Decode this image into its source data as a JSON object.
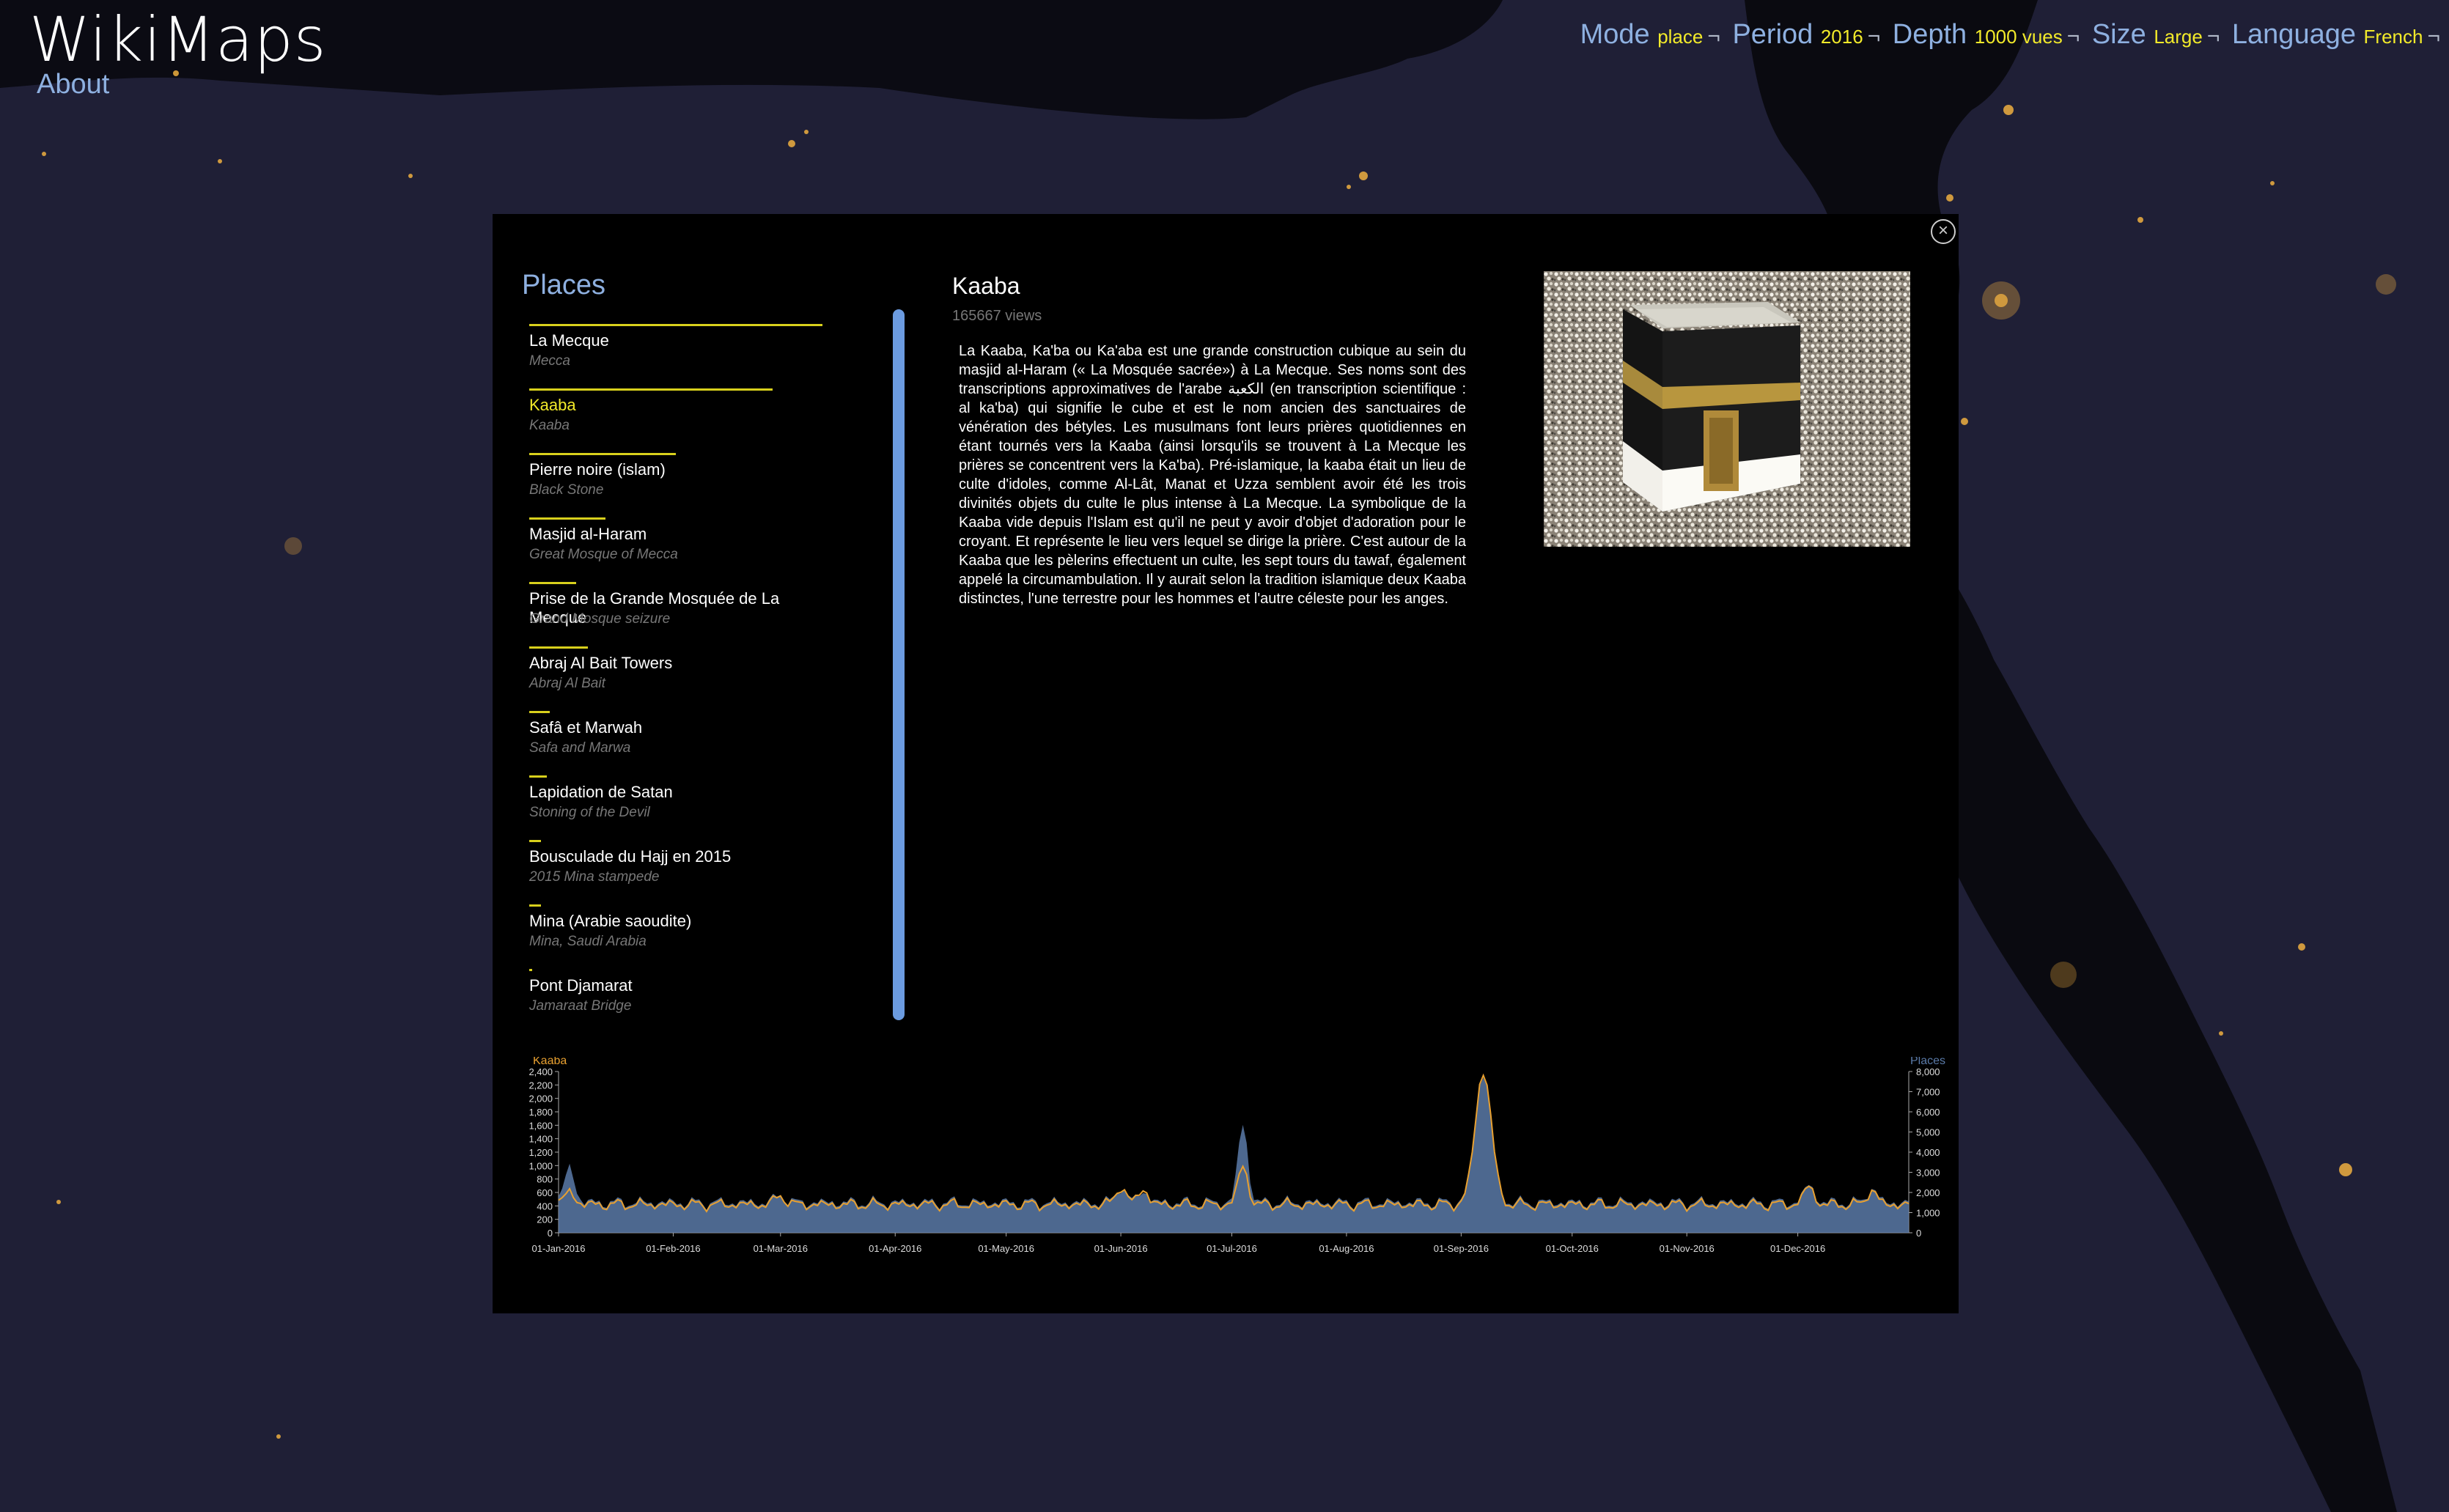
{
  "app": {
    "title": "WikiMaps",
    "about_label": "About"
  },
  "nav": {
    "items": [
      {
        "label": "Mode",
        "value": "place"
      },
      {
        "label": "Period",
        "value": "2016"
      },
      {
        "label": "Depth",
        "value": "1000 vues"
      },
      {
        "label": "Size",
        "value": "Large"
      },
      {
        "label": "Language",
        "value": "French"
      }
    ],
    "separator": "¬"
  },
  "panel": {
    "close_icon": "close-circle-icon",
    "places_title": "Places",
    "places": [
      {
        "name": "La Mecque",
        "english": "Mecca",
        "weight": 1.0,
        "active": false
      },
      {
        "name": "Kaaba",
        "english": "Kaaba",
        "weight": 0.83,
        "active": true
      },
      {
        "name": "Pierre noire (islam)",
        "english": "Black Stone",
        "weight": 0.5,
        "active": false
      },
      {
        "name": "Masjid al-Haram",
        "english": "Great Mosque of Mecca",
        "weight": 0.26,
        "active": false
      },
      {
        "name": "Prise de la Grande Mosquée de La Mecque",
        "english": "Grand Mosque seizure",
        "weight": 0.16,
        "active": false
      },
      {
        "name": "Abraj Al Bait Towers",
        "english": "Abraj Al Bait",
        "weight": 0.2,
        "active": false
      },
      {
        "name": "Safâ et Marwah",
        "english": "Safa and Marwa",
        "weight": 0.07,
        "active": false
      },
      {
        "name": "Lapidation de Satan",
        "english": "Stoning of the Devil",
        "weight": 0.06,
        "active": false
      },
      {
        "name": "Bousculade du Hajj en 2015",
        "english": "2015 Mina stampede",
        "weight": 0.04,
        "active": false
      },
      {
        "name": "Mina (Arabie saoudite)",
        "english": "Mina, Saudi Arabia",
        "weight": 0.04,
        "active": false
      },
      {
        "name": "Pont Djamarat",
        "english": "Jamaraat Bridge",
        "weight": 0.01,
        "active": false
      }
    ],
    "detail": {
      "title": "Kaaba",
      "views": "165667 views",
      "text": "La Kaaba, Ka'ba ou Ka'aba est une grande construction cubique au sein du masjid al-Haram (« La Mosquée sacrée») à La Mecque. Ses noms sont des transcriptions approximatives de l'arabe الكعبة (en transcription scientifique : al ka'ba) qui signifie le cube et est le nom ancien des sanctuaires de vénération des bétyles. Les musulmans font leurs prières quotidiennes en étant tournés vers la Kaaba (ainsi lorsqu'ils se trouvent à La Mecque les prières se concentrent vers la Ka'ba). Pré-islamique, la kaaba était un lieu de culte d'idoles, comme Al-Lât, Manat et Uzza semblent avoir été les trois divinités objets du culte le plus intense à La Mecque. La symbolique de la Kaaba vide depuis l'Islam est qu'il ne peut y avoir d'objet d'adoration pour le croyant. Et représente le lieu vers lequel se dirige la prière. C'est autour de la Kaaba que les pèlerins effectuent un culte, les sept tours du tawaf, également appelé la circumambulation. Il y aurait selon la tradition islamique deux Kaaba distinctes, l'une terrestre pour les hommes et l'autre céleste pour les anges.",
      "image": "kaaba-photo"
    }
  },
  "chart_data": {
    "type": "area",
    "series": [
      {
        "name": "Kaaba",
        "color": "#e8a030",
        "axis": "left",
        "ylim": [
          0,
          2400
        ],
        "yticks": [
          "0",
          "200",
          "400",
          "600",
          "800",
          "1,000",
          "1,200",
          "1,400",
          "1,600",
          "1,800",
          "2,000",
          "2,200",
          "2,400"
        ]
      },
      {
        "name": "Places",
        "color": "#5a7aa8",
        "axis": "right",
        "ylim": [
          0,
          8000
        ],
        "yticks": [
          "0",
          "1,000",
          "2,000",
          "3,000",
          "4,000",
          "5,000",
          "6,000",
          "7,000",
          "8,000"
        ]
      }
    ],
    "xticks": [
      "01-Jan-2016",
      "01-Feb-2016",
      "01-Mar-2016",
      "01-Apr-2016",
      "01-May-2016",
      "01-Jun-2016",
      "01-Jul-2016",
      "01-Aug-2016",
      "01-Sep-2016",
      "01-Oct-2016",
      "01-Nov-2016",
      "01-Dec-2016"
    ],
    "baseline": {
      "kaaba": 420,
      "places": 1500
    },
    "peaks": [
      {
        "day": 3,
        "kaaba": 620,
        "places": 3300
      },
      {
        "day": 60,
        "kaaba": 560,
        "places": 1900
      },
      {
        "day": 152,
        "kaaba": 700,
        "places": 2300
      },
      {
        "day": 158,
        "kaaba": 660,
        "places": 2100
      },
      {
        "day": 185,
        "kaaba": 1000,
        "places": 5400
      },
      {
        "day": 250,
        "kaaba": 2400,
        "places": 7900
      },
      {
        "day": 338,
        "kaaba": 700,
        "places": 2400
      },
      {
        "day": 355,
        "kaaba": 640,
        "places": 2200
      }
    ]
  }
}
